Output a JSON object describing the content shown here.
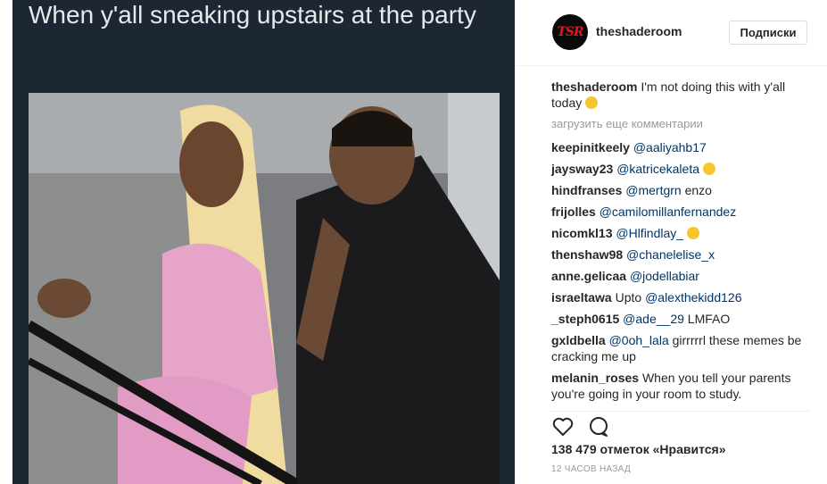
{
  "post": {
    "meme_caption": "When y'all sneaking upstairs at the party",
    "account": {
      "username": "theshaderoom",
      "avatar_text": "TSR",
      "follow_label": "Подписки"
    },
    "caption": {
      "user": "theshaderoom",
      "text": "I'm not doing this with y'all today",
      "emoji": "laughing-crying-emoji"
    },
    "load_more_label": "загрузить еще комментарии",
    "comments": [
      {
        "user": "keepinitkeely",
        "mention": "@aaliyahb17",
        "text": ""
      },
      {
        "user": "jaysway23",
        "mention": "@katricekaleta",
        "text": "",
        "emoji": "smirk-emoji"
      },
      {
        "user": "hindfranses",
        "mention": "@mertgrn",
        "text": " enzo"
      },
      {
        "user": "frijolles",
        "mention": "@camilomillanfernandez",
        "text": ""
      },
      {
        "user": "nicomkl13",
        "mention": "@Hlfindlay_",
        "text": "",
        "emoji": "laughing-crying-emoji"
      },
      {
        "user": "thenshaw98",
        "mention": "@chanelelise_x",
        "text": ""
      },
      {
        "user": "anne.gelicaa",
        "mention": "@jodellabiar",
        "text": ""
      },
      {
        "user": "israeltawa",
        "pre": "Upto ",
        "mention": "@alexthekidd126",
        "text": ""
      },
      {
        "user": "_steph0615",
        "mention": "@ade__29",
        "text": " LMFAO"
      },
      {
        "user": "gxldbella",
        "mention": "@0oh_lala",
        "text": " girrrrrl these memes be cracking me up"
      },
      {
        "user": "melanin_roses",
        "mention": "",
        "text": "When you tell your parents you're going in your room to study."
      }
    ],
    "likes_label": "138 479 отметок «Нравится»",
    "time_label": "12 ЧАСОВ НАЗАД"
  }
}
